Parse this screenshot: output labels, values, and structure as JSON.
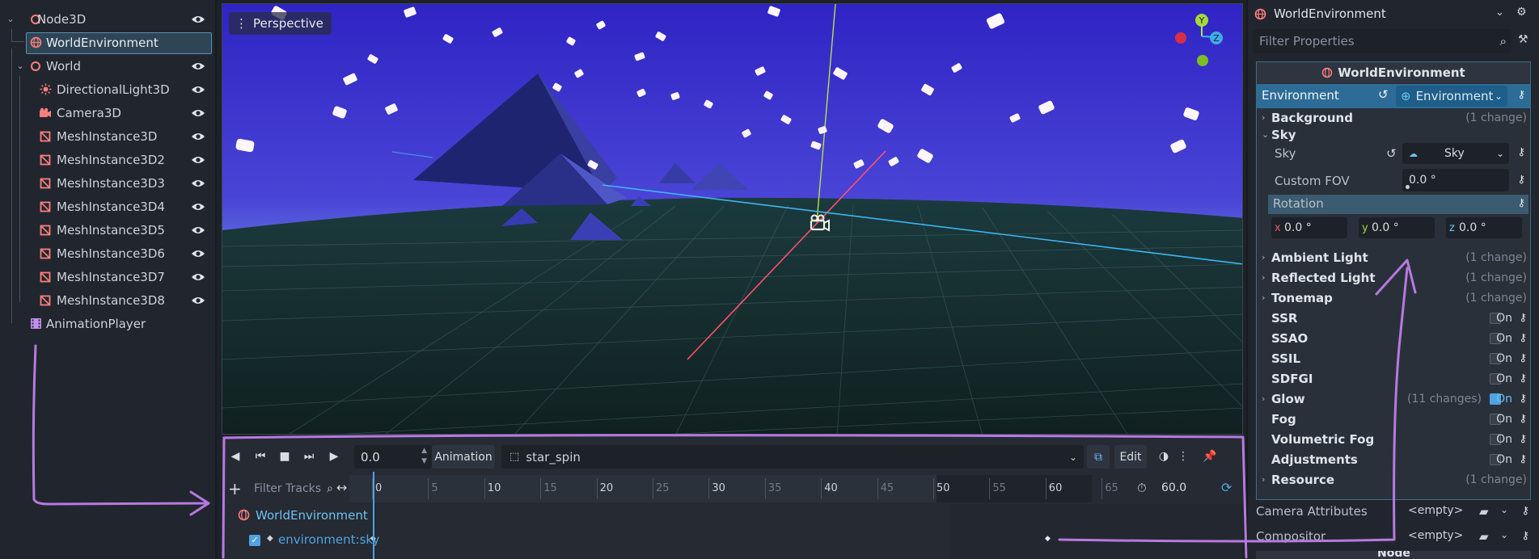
{
  "scene_tree": {
    "nodes": [
      {
        "label": "Node3D",
        "icon": "node3d-icon",
        "expanded": true
      },
      {
        "label": "WorldEnvironment",
        "icon": "world-environment-icon",
        "selected": true
      },
      {
        "label": "World",
        "icon": "node3d-icon",
        "expanded": true
      },
      {
        "label": "DirectionalLight3D",
        "icon": "directional-light-icon"
      },
      {
        "label": "Camera3D",
        "icon": "camera-icon"
      },
      {
        "label": "MeshInstance3D",
        "icon": "mesh-icon"
      },
      {
        "label": "MeshInstance3D2",
        "icon": "mesh-icon"
      },
      {
        "label": "MeshInstance3D3",
        "icon": "mesh-icon"
      },
      {
        "label": "MeshInstance3D4",
        "icon": "mesh-icon"
      },
      {
        "label": "MeshInstance3D5",
        "icon": "mesh-icon"
      },
      {
        "label": "MeshInstance3D6",
        "icon": "mesh-icon"
      },
      {
        "label": "MeshInstance3D7",
        "icon": "mesh-icon"
      },
      {
        "label": "MeshInstance3D8",
        "icon": "mesh-icon"
      },
      {
        "label": "AnimationPlayer",
        "icon": "animation-player-icon"
      }
    ]
  },
  "viewport": {
    "mode_label": "Perspective",
    "gizmo": {
      "y_label": "Y",
      "z_label": "Z"
    }
  },
  "animation": {
    "time_value": "0.0",
    "animation_label": "Animation",
    "current_animation": "star_spin",
    "edit_label": "Edit",
    "filter_placeholder": "Filter Tracks",
    "ruler": [
      "0",
      "5",
      "10",
      "15",
      "20",
      "25",
      "30",
      "35",
      "40",
      "45",
      "50",
      "55",
      "60",
      "65"
    ],
    "length_value": "60.0",
    "tracks": {
      "node_label": "WorldEnvironment",
      "property_label": "environment:sky"
    }
  },
  "inspector": {
    "node_title": "WorldEnvironment",
    "filter_placeholder": "Filter Properties",
    "section_title": "WorldEnvironment",
    "environment": {
      "label": "Environment",
      "resource": "Environment"
    },
    "groups": {
      "background": {
        "label": "Background",
        "change": "(1 change)"
      },
      "sky": {
        "label": "Sky"
      },
      "sky_prop": {
        "label": "Sky",
        "value": "Sky"
      },
      "custom_fov": {
        "label": "Custom FOV",
        "value": "0.0 °"
      },
      "rotation": {
        "label": "Rotation",
        "x_label": "x",
        "x": "0.0 °",
        "y_label": "y",
        "y": "0.0 °",
        "z_label": "z",
        "z": "0.0 °"
      },
      "ambient_light": {
        "label": "Ambient Light",
        "change": "(1 change)"
      },
      "reflected_light": {
        "label": "Reflected Light",
        "change": "(1 change)"
      },
      "tonemap": {
        "label": "Tonemap",
        "change": "(1 change)"
      },
      "ssr": {
        "label": "SSR",
        "on": "On"
      },
      "ssao": {
        "label": "SSAO",
        "on": "On"
      },
      "ssil": {
        "label": "SSIL",
        "on": "On"
      },
      "sdfgi": {
        "label": "SDFGI",
        "on": "On"
      },
      "glow": {
        "label": "Glow",
        "change": "(11 changes)",
        "on": "On"
      },
      "fog": {
        "label": "Fog",
        "on": "On"
      },
      "volumetric_fog": {
        "label": "Volumetric Fog",
        "on": "On"
      },
      "adjustments": {
        "label": "Adjustments",
        "on": "On"
      },
      "resource": {
        "label": "Resource",
        "change": "(1 change)"
      }
    },
    "camera_attributes": {
      "label": "Camera Attributes",
      "value": "<empty>"
    },
    "compositor": {
      "label": "Compositor",
      "value": "<empty>"
    },
    "node_section": "Node"
  },
  "colors": {
    "accent": "#4fa3e0",
    "annotation": "#b779e0",
    "sky_top": "#3a2fc8",
    "sky_horizon": "#7fb6ee"
  }
}
